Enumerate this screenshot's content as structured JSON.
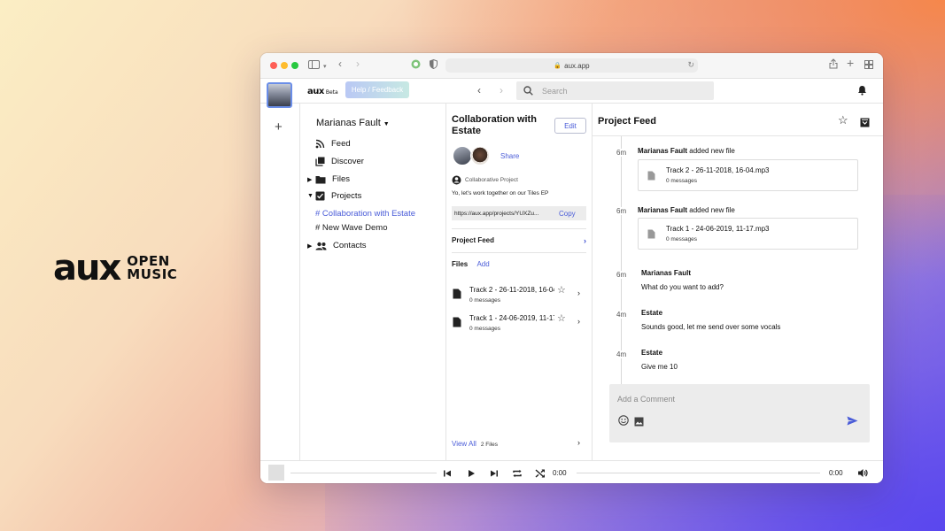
{
  "brand": {
    "logo": "aux",
    "line1": "OPEN",
    "line2": "MUSIC"
  },
  "browser": {
    "url": "aux.app"
  },
  "header": {
    "logo": "aux",
    "beta": "Beta",
    "help_label": "Help / Feedback",
    "search_placeholder": "Search"
  },
  "sidebar": {
    "user": "Marianas Fault",
    "items": [
      {
        "label": "Feed",
        "icon": "rss-icon"
      },
      {
        "label": "Discover",
        "icon": "library-icon"
      },
      {
        "label": "Files",
        "icon": "folder-icon"
      },
      {
        "label": "Projects",
        "icon": "checkbox-icon"
      },
      {
        "label": "Contacts",
        "icon": "people-icon"
      }
    ],
    "projects": [
      {
        "label": "# Collaboration with Estate"
      },
      {
        "label": "# New Wave Demo"
      }
    ]
  },
  "project": {
    "title": "Collaboration with Estate",
    "edit_label": "Edit",
    "share_label": "Share",
    "type_label": "Collaborative Project",
    "description": "Yo, let's work together on our Tiles EP",
    "link": "https://aux.app/projects/YUXZu...",
    "copy_label": "Copy",
    "feed_label": "Project Feed",
    "files_label": "Files",
    "add_label": "Add",
    "files": [
      {
        "name": "Track 2 - 26-11-2018, 16-04.mp3",
        "messages": "0 messages"
      },
      {
        "name": "Track 1 - 24-06-2019, 11-17.mp3",
        "messages": "0 messages"
      }
    ],
    "view_all": "View All",
    "files_count": "2 Files"
  },
  "feed": {
    "title": "Project Feed",
    "events": [
      {
        "time": "6m",
        "user": "Marianas Fault",
        "action": "added new file",
        "file": "Track 2 - 26-11-2018, 16-04.mp3",
        "messages": "0 messages"
      },
      {
        "time": "6m",
        "user": "Marianas Fault",
        "action": "added new file",
        "file": "Track 1 - 24-06-2019, 11-17.mp3",
        "messages": "0 messages"
      }
    ],
    "comments": [
      {
        "time": "6m",
        "user": "Marianas Fault",
        "text": "What do you want to add?"
      },
      {
        "time": "4m",
        "user": "Estate",
        "text": "Sounds good, let me send over some vocals"
      },
      {
        "time": "4m",
        "user": "Estate",
        "text": "Give me 10"
      }
    ],
    "comment_placeholder": "Add a Comment"
  },
  "player": {
    "time_start": "0:00",
    "time_end": "0:00"
  },
  "colors": {
    "accent": "#4a5cd8"
  }
}
